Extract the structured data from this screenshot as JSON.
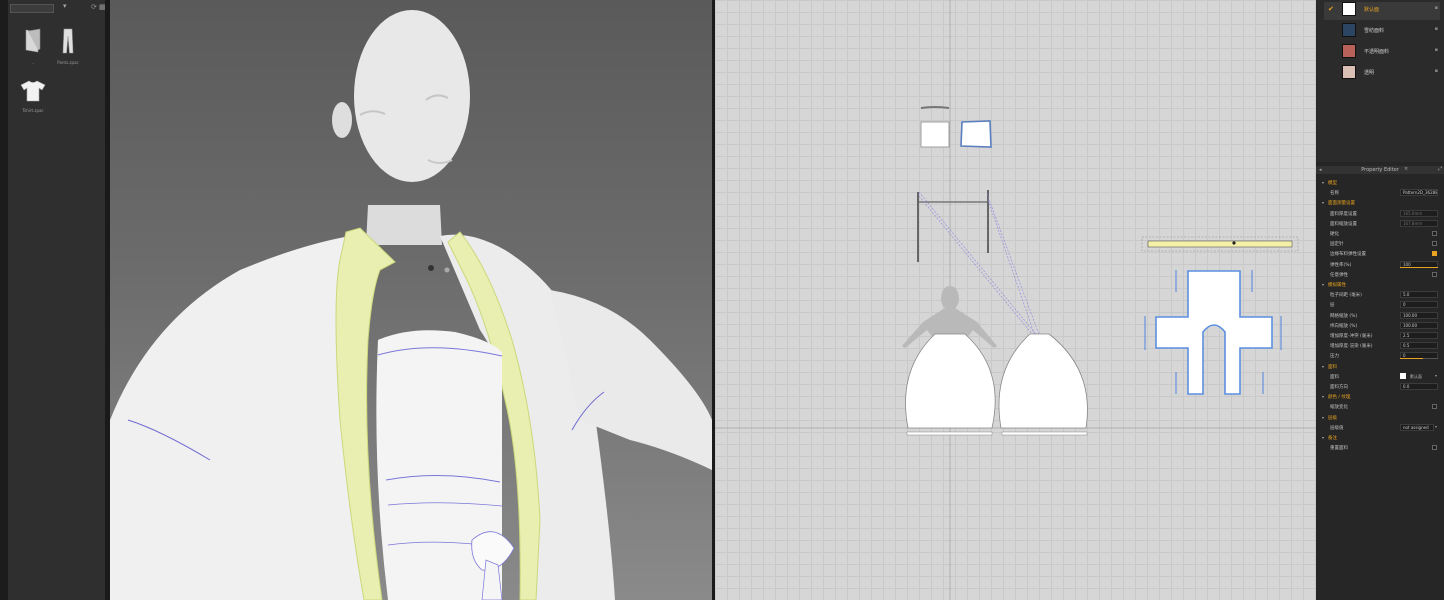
{
  "library": {
    "items": [
      {
        "icon": "folder-up-icon",
        "label": ".."
      },
      {
        "icon": "pants-icon",
        "label": "Pants.zpac"
      },
      {
        "icon": "tshirt-icon",
        "label": "Tshirt.zpac"
      }
    ]
  },
  "fabrics": [
    {
      "name": "默认面",
      "color": "#ffffff",
      "active": true
    },
    {
      "name": "雪纺面料",
      "color": "#2c4563",
      "active": false
    },
    {
      "name": "不透明面料",
      "color": "#b8615a",
      "active": false
    },
    {
      "name": "透明",
      "color": "#d9bfb4",
      "active": false
    }
  ],
  "property_editor": {
    "title": "Property Editor",
    "rows": [
      {
        "label": "模型",
        "type": "section"
      },
      {
        "label": "名称",
        "value": "Pattern2D_362886"
      },
      {
        "label": "面面测量设置",
        "type": "section"
      },
      {
        "label": "面料厚度设置",
        "value": "165.0mm",
        "dim": true
      },
      {
        "label": "面料缩放设置",
        "value": "167.8mm",
        "dim": true
      },
      {
        "label": "硬化",
        "type": "checkbox"
      },
      {
        "label": "固定针",
        "type": "checkbox"
      },
      {
        "label": "边缘布料弹性设置",
        "type": "checkbox",
        "checked": true
      },
      {
        "label": "弹性率(%)",
        "value": "100",
        "slider": 1.0
      },
      {
        "label": "任意弹性",
        "type": "checkbox"
      },
      {
        "label": "模拟属性",
        "type": "section"
      },
      {
        "label": "粒子间距 (毫米)",
        "value": "5.0"
      },
      {
        "label": "层",
        "value": "0"
      },
      {
        "label": "网格缩放 (%)",
        "value": "100.00"
      },
      {
        "label": "纬向缩放 (%)",
        "value": "100.00"
      },
      {
        "label": "增加厚度-冲突 (毫米)",
        "value": "2.5"
      },
      {
        "label": "增加厚度-渲染 (毫米)",
        "value": "0.5"
      },
      {
        "label": "压力",
        "value": "0",
        "slider": 0.6
      },
      {
        "label": "面料",
        "type": "section"
      },
      {
        "label": "面料",
        "type": "fabric",
        "swatch": "#ffffff",
        "value": "默认面"
      },
      {
        "label": "面料方向",
        "value": "0.0"
      },
      {
        "label": "颜色 / 纹理",
        "type": "section"
      },
      {
        "label": "缩放变化",
        "type": "checkbox"
      },
      {
        "label": "层级",
        "type": "section"
      },
      {
        "label": "层级值",
        "value": "not assigned",
        "type": "select"
      },
      {
        "label": "备注",
        "type": "section"
      },
      {
        "label": "重置面料",
        "type": "checkbox"
      }
    ]
  }
}
